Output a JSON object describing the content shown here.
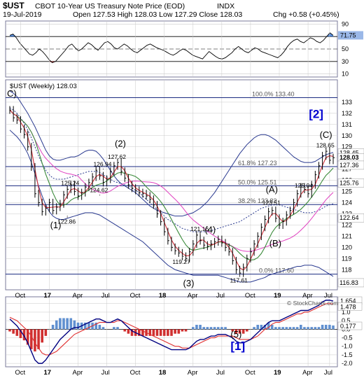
{
  "header": {
    "symbol": "$UST",
    "exchange_desc": "CBOT 10-Year US Treasury Note Price (EOD)",
    "tag": "INDX",
    "date": "19-Jul-2019",
    "ohlc": "Open 127.53  High 128.03  Low 127.29  Close 128.03",
    "chg": "Chg +0.58 (+0.45%)"
  },
  "colors": {
    "background": "#ffffff",
    "border": "#7a7a9a",
    "grid": "#c9c9c9",
    "price_bars": "#000000",
    "ma_fast": "#d0303a",
    "ma_mid": "#3a8a3a",
    "ma_slow": "#e040c0",
    "band": "#2a3a90",
    "macd_line": "#000080",
    "macd_signal": "#e03030",
    "hist_pos": "#6090d0",
    "hist_neg": "#d03030",
    "label_box": "#1e4cb2",
    "wave_blue": "#0000d0",
    "rsi_red": "#d03030",
    "rsi_blue": "#3070d0"
  },
  "chart_data": [
    {
      "type": "line",
      "name": "RSI panel",
      "ylim": [
        5,
        95
      ],
      "y_ticks": [
        10,
        30,
        50,
        70,
        90
      ],
      "current_label": "71.75",
      "values": [
        72,
        74,
        68,
        60,
        54,
        48,
        42,
        40,
        44,
        50,
        46,
        40,
        33,
        28,
        30,
        36,
        42,
        48,
        55,
        58,
        52,
        47,
        50,
        55,
        60,
        57,
        52,
        48,
        54,
        60,
        62,
        58,
        52,
        50,
        54,
        58,
        55,
        50,
        46,
        44,
        48,
        52,
        56,
        58,
        55,
        52,
        50,
        48,
        45,
        42,
        40,
        43,
        47,
        50,
        48,
        44,
        40,
        38,
        36,
        34,
        40,
        46,
        42,
        38,
        35,
        34,
        36,
        40,
        44,
        50,
        54,
        50,
        46,
        44,
        48,
        52,
        50,
        46,
        44,
        42,
        40,
        38,
        36,
        40,
        46,
        54,
        60,
        64,
        66,
        62,
        60,
        64,
        68,
        66,
        62,
        60,
        64,
        70,
        76,
        72
      ]
    },
    {
      "type": "bar",
      "name": "$UST (Weekly)",
      "legend": "$UST (Weekly) 128.03",
      "ylim": [
        116.2,
        135
      ],
      "y_ticks": [
        118,
        119,
        120,
        121,
        122,
        123,
        124,
        125,
        126,
        127,
        128,
        129,
        130,
        131,
        132,
        133
      ],
      "x_tick_labels": [
        "Oct",
        "17",
        "Apr",
        "Jul",
        "Oct",
        "18",
        "Apr",
        "Jul",
        "Oct",
        "19",
        "Apr",
        "Jul"
      ],
      "close": [
        132.3,
        131.6,
        131.4,
        130.6,
        130.1,
        129.0,
        127.2,
        124.8,
        124.0,
        123.2,
        123.5,
        124.0,
        123.3,
        123.6,
        123.9,
        124.7,
        125.2,
        125.6,
        125.0,
        124.6,
        124.9,
        125.4,
        125.8,
        126.3,
        126.9,
        126.4,
        125.8,
        126.1,
        126.8,
        127.3,
        127.6,
        126.8,
        126.2,
        125.6,
        125.3,
        125.1,
        124.9,
        124.8,
        124.6,
        124.3,
        123.8,
        123.0,
        122.3,
        121.4,
        120.6,
        120.0,
        119.7,
        119.5,
        119.2,
        119.0,
        119.6,
        120.3,
        121.1,
        120.6,
        120.2,
        120.1,
        120.3,
        120.5,
        120.7,
        120.4,
        120.0,
        119.6,
        118.8,
        118.0,
        117.7,
        118.2,
        119.0,
        119.6,
        120.3,
        121.0,
        121.8,
        122.5,
        123.2,
        123.3,
        122.6,
        122.0,
        122.3,
        122.9,
        123.3,
        124.0,
        124.8,
        125.4,
        125.2,
        124.8,
        125.6,
        126.5,
        127.3,
        128.2,
        128.6,
        127.8,
        128.03
      ],
      "bands": {
        "upper": [
          134,
          133.8,
          133.5,
          133,
          132.5,
          132,
          131.4,
          130.8,
          130.1,
          129.4,
          128.7,
          128.2,
          127.9,
          127.8,
          127.8,
          127.9,
          128,
          128.1,
          128.1,
          128.2,
          128.4,
          128.6,
          128.7,
          128.7,
          128.6,
          128.3,
          127.9,
          127.4,
          126.9,
          126.4,
          126,
          125.7,
          125.5,
          125.3,
          125.1,
          124.9,
          124.6,
          124.3,
          124.0,
          123.7,
          123.5,
          123.3,
          123.2,
          123.1,
          123.0,
          122.9,
          122.8,
          122.8,
          122.8,
          122.9,
          123.0,
          123.1,
          123.3,
          123.5,
          123.8,
          124.1,
          124.5,
          124.9,
          125.4,
          125.9,
          126.4,
          126.9,
          127.4,
          127.9,
          128.4,
          128.8,
          129.2,
          129.5,
          129.8,
          130.0,
          130.1,
          130.1,
          130.0,
          129.8,
          129.6,
          129.3,
          129.0,
          128.7,
          128.4,
          128.1,
          127.9,
          127.7,
          127.6,
          127.6,
          127.6,
          127.7,
          127.9,
          128.1,
          128.3,
          128.4,
          128.5
        ],
        "lower": [
          130.5,
          130.2,
          129.9,
          129.5,
          129.0,
          128.4,
          127.6,
          126.6,
          125.5,
          124.6,
          123.8,
          123.2,
          122.8,
          122.6,
          122.5,
          122.5,
          122.6,
          122.7,
          122.8,
          122.9,
          123.0,
          123.1,
          123.1,
          123.1,
          123.0,
          122.9,
          122.7,
          122.5,
          122.3,
          122.1,
          121.9,
          121.7,
          121.5,
          121.3,
          121.1,
          120.9,
          120.7,
          120.5,
          120.2,
          119.9,
          119.6,
          119.3,
          119.0,
          118.7,
          118.4,
          118.2,
          118.0,
          117.9,
          117.8,
          117.7,
          117.6,
          117.5,
          117.5,
          117.5,
          117.5,
          117.5,
          117.5,
          117.5,
          117.5,
          117.4,
          117.3,
          117.2,
          117.1,
          117.0,
          116.9,
          116.9,
          116.9,
          116.9,
          117.0,
          117.1,
          117.2,
          117.3,
          117.5,
          117.6,
          117.7,
          117.8,
          117.9,
          118.0,
          118.1,
          118.2,
          118.3,
          118.3,
          118.4,
          118.4,
          118.4,
          118.3,
          118.2,
          118.0,
          117.8,
          117.6,
          117.4
        ],
        "mid": [
          132.5,
          132.3,
          132.0,
          131.6,
          131.1,
          130.5,
          129.8,
          129.0,
          128.2,
          127.5,
          126.9,
          126.5,
          126.2,
          126.1,
          126.1,
          126.1,
          126.2,
          126.3,
          126.4,
          126.5,
          126.6,
          126.7,
          126.8,
          126.8,
          126.8,
          126.7,
          126.5,
          126.3,
          126.1,
          125.9,
          125.8,
          125.7,
          125.6,
          125.5,
          125.3,
          125.1,
          124.9,
          124.6,
          124.3,
          124.0,
          123.7,
          123.4,
          123.1,
          122.8,
          122.5,
          122.3,
          122.1,
          121.9,
          121.7,
          121.6,
          121.5,
          121.4,
          121.4,
          121.4,
          121.4,
          121.4,
          121.5,
          121.6,
          121.7,
          121.8,
          121.9,
          122.0,
          122.1,
          122.2,
          122.3,
          122.5,
          122.7,
          122.9,
          123.1,
          123.3,
          123.5,
          123.6,
          123.7,
          123.8,
          123.8,
          123.8,
          123.7,
          123.6,
          123.5,
          123.4,
          123.3,
          123.2,
          123.1,
          123.1,
          123.1,
          123.2,
          123.3,
          123.5,
          123.7,
          123.8,
          123.9
        ]
      },
      "price_labels": [
        {
          "text": "122.86",
          "x": 16,
          "y": 122.86
        },
        {
          "text": "125.24",
          "x": 17,
          "y": 125.24
        },
        {
          "text": "126.94",
          "x": 26,
          "y": 126.94
        },
        {
          "text": "127.62",
          "x": 30,
          "y": 127.62
        },
        {
          "text": "124.62",
          "x": 25,
          "y": 124.62
        },
        {
          "text": "121.16",
          "x": 53,
          "y": 121.16
        },
        {
          "text": "119.27",
          "x": 48,
          "y": 119.27
        },
        {
          "text": "117.61",
          "x": 64,
          "y": 117.61
        },
        {
          "text": "123.51",
          "x": 73,
          "y": 123.51
        },
        {
          "text": "125.04",
          "x": 82,
          "y": 125.04
        },
        {
          "text": "128.65",
          "x": 88,
          "y": 128.65
        }
      ],
      "fib_levels": [
        {
          "text": "100.0% 133.40",
          "y": 133.4
        },
        {
          "text": "61.8% 127.23",
          "y": 127.23
        },
        {
          "text": "50.0% 125.51",
          "y": 125.51
        },
        {
          "text": "38.2% 123.83",
          "y": 123.83
        },
        {
          "text": "0.0% 117.60",
          "y": 117.6
        }
      ],
      "wave_labels": [
        {
          "text": "(1)",
          "x": 12,
          "y": 121.7
        },
        {
          "text": "(2)",
          "x": 30,
          "y": 129.0
        },
        {
          "text": "(3)",
          "x": 49,
          "y": 116.5
        },
        {
          "text": "(4)",
          "x": 55,
          "y": 121.3
        },
        {
          "text": "(A)",
          "x": 72,
          "y": 124.9
        },
        {
          "text": "(B)",
          "x": 73,
          "y": 120.1
        },
        {
          "text": "(C)",
          "x": 87,
          "y": 129.8
        },
        {
          "text": "C)",
          "x": 0,
          "y": 133.5
        },
        {
          "text": "[2]",
          "x": 84,
          "y": 131.6
        }
      ],
      "right_tags": [
        {
          "text": "128.45",
          "y": 128.45
        },
        {
          "text": "128.03",
          "y": 128.03
        },
        {
          "text": "127.36",
          "y": 127.36
        },
        {
          "text": "125.76",
          "y": 125.76
        },
        {
          "text": "122.64",
          "y": 122.64
        },
        {
          "text": "116.83",
          "y": 116.83
        }
      ]
    },
    {
      "type": "area",
      "name": "MACD panel",
      "ylim": [
        -2.2,
        1.9
      ],
      "y_ticks": [
        -2.0,
        -1.5,
        -1.0,
        -0.5,
        0.0,
        0.5,
        1.0,
        1.5
      ],
      "tags": [
        "1.654",
        "1.478",
        "0.177"
      ],
      "x_tick_labels": [
        "Oct",
        "17",
        "Apr",
        "Jul",
        "Oct",
        "18",
        "Apr",
        "Jul",
        "Oct",
        "19",
        "Apr",
        "Jul"
      ],
      "macd": [
        0.6,
        0.4,
        0.2,
        -0.1,
        -0.4,
        -0.8,
        -1.3,
        -1.8,
        -2.0,
        -2.0,
        -1.8,
        -1.5,
        -1.2,
        -0.9,
        -0.6,
        -0.4,
        -0.2,
        0.0,
        0.1,
        0.1,
        0.2,
        0.3,
        0.4,
        0.5,
        0.6,
        0.6,
        0.5,
        0.4,
        0.4,
        0.5,
        0.6,
        0.5,
        0.3,
        0.1,
        -0.1,
        -0.2,
        -0.3,
        -0.4,
        -0.5,
        -0.6,
        -0.7,
        -0.8,
        -0.9,
        -1.0,
        -1.1,
        -1.2,
        -1.2,
        -1.2,
        -1.2,
        -1.2,
        -1.1,
        -0.9,
        -0.7,
        -0.6,
        -0.6,
        -0.5,
        -0.4,
        -0.4,
        -0.3,
        -0.3,
        -0.3,
        -0.4,
        -0.5,
        -0.7,
        -0.8,
        -0.8,
        -0.7,
        -0.6,
        -0.4,
        -0.2,
        0.0,
        0.2,
        0.4,
        0.5,
        0.5,
        0.5,
        0.6,
        0.7,
        0.8,
        0.9,
        1.0,
        1.1,
        1.1,
        1.1,
        1.2,
        1.3,
        1.4,
        1.6,
        1.7,
        1.7,
        1.65
      ],
      "signal": [
        0.7,
        0.6,
        0.5,
        0.3,
        0.1,
        -0.1,
        -0.4,
        -0.8,
        -1.1,
        -1.4,
        -1.5,
        -1.5,
        -1.4,
        -1.3,
        -1.1,
        -0.9,
        -0.7,
        -0.5,
        -0.3,
        -0.2,
        -0.1,
        0.0,
        0.1,
        0.2,
        0.3,
        0.4,
        0.4,
        0.4,
        0.4,
        0.4,
        0.5,
        0.5,
        0.4,
        0.3,
        0.2,
        0.1,
        0.0,
        -0.1,
        -0.2,
        -0.3,
        -0.4,
        -0.5,
        -0.6,
        -0.7,
        -0.8,
        -0.9,
        -1.0,
        -1.0,
        -1.1,
        -1.1,
        -1.1,
        -1.0,
        -0.9,
        -0.8,
        -0.7,
        -0.6,
        -0.5,
        -0.5,
        -0.4,
        -0.4,
        -0.4,
        -0.4,
        -0.4,
        -0.5,
        -0.6,
        -0.6,
        -0.6,
        -0.6,
        -0.5,
        -0.4,
        -0.2,
        0.0,
        0.1,
        0.3,
        0.4,
        0.4,
        0.5,
        0.6,
        0.7,
        0.8,
        0.9,
        0.9,
        1.0,
        1.0,
        1.1,
        1.2,
        1.3,
        1.4,
        1.5,
        1.5,
        1.48
      ],
      "wave_labels": [
        {
          "text": "(5)"
        },
        {
          "text": "[1]"
        }
      ]
    }
  ],
  "watermark": "© StockCharts.com"
}
